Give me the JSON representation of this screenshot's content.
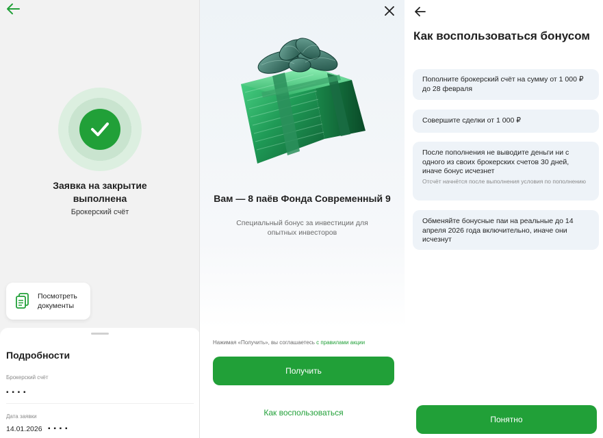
{
  "completion_screen": {
    "title": "Заявка на закрытие выполнена",
    "subtitle": "Брокерский счёт",
    "documents_button": "Посмотреть документы",
    "details": {
      "heading": "Подробности",
      "account_label": "Брокерский счёт",
      "account_value": "▪ ▪ ▪ ▪",
      "date_label": "Дата заявки",
      "date_value": "14.01.2026",
      "date_extra": "▪ ▪ ▪ ▪"
    }
  },
  "offer_screen": {
    "title": "Вам — 8 паёв Фонда Современный 9",
    "subtitle": "Специальный бонус за инвестиции для опытных инвесторов",
    "terms_prefix": "Нажимая «Получить», вы соглашаетесь",
    "terms_link": "с правилами акции",
    "primary_button": "Получить",
    "secondary_link": "Как воспользоваться"
  },
  "howto_screen": {
    "title": "Как воспользоваться бонусом",
    "steps": [
      {
        "text": "Пополните брокерский счёт на сумму от 1 000 ₽ до 28 февраля",
        "note": ""
      },
      {
        "text": "Совершите сделки от 1 000 ₽",
        "note": ""
      },
      {
        "text": "После пополнения не выводите деньги ни с одного из своих брокерских счетов 30 дней, иначе бонус исчезнет",
        "note": "Отсчёт начнётся после выполнения условия по пополнению"
      },
      {
        "text": "Обменяйте бонусные паи на реальные до 14 апреля 2026 года включительно, иначе они исчезнут",
        "note": ""
      }
    ],
    "ok_button": "Понятно"
  },
  "colors": {
    "accent": "#21a038",
    "card_bg": "#eef3f8",
    "screen_bg": "#f2f2f2"
  },
  "icons": [
    "back-arrow-icon",
    "success-check-icon",
    "documents-icon",
    "close-icon",
    "gift-box-icon"
  ]
}
